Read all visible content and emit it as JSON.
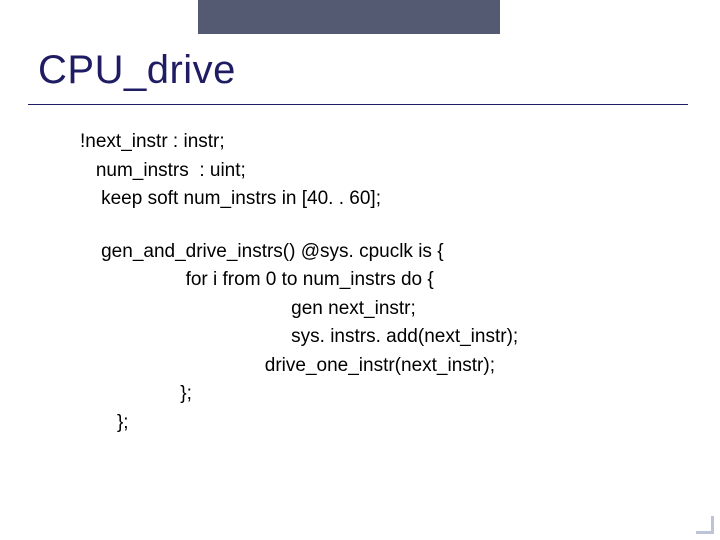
{
  "title": "CPU_drive",
  "code": {
    "l1": "!next_instr : instr;",
    "l2": "   num_instrs  : uint;",
    "l3": "    keep soft num_instrs in [40. . 60];",
    "l4": "    gen_and_drive_instrs() @sys. cpuclk is {",
    "l5": "                    for i from 0 to num_instrs do {",
    "l6": "                                        gen next_instr;",
    "l7": "                                        sys. instrs. add(next_instr);",
    "l8": "                                   drive_one_instr(next_instr);",
    "l9": "                   };",
    "l10": "       };"
  }
}
